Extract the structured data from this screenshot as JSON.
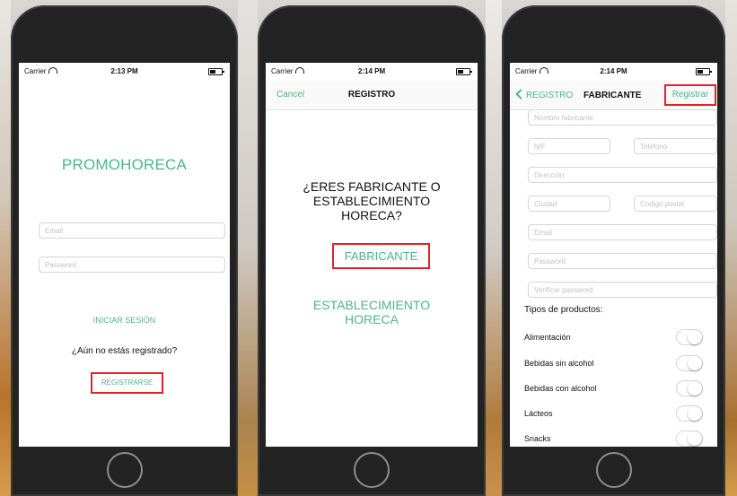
{
  "screen1": {
    "status": {
      "carrier": "Carrier",
      "time": "2:13 PM"
    },
    "app_title": "PROMOHORECA",
    "email_placeholder": "Email",
    "password_placeholder": "Password",
    "login_button": "INICIAR SESIÓN",
    "not_registered": "¿Aún no estás registrado?",
    "register_button": "REGISTRARSE"
  },
  "screen2": {
    "status": {
      "carrier": "Carrier",
      "time": "2:14 PM"
    },
    "nav": {
      "cancel": "Cancel",
      "title": "REGISTRO"
    },
    "question": "¿ERES FABRICANTE O ESTABLECIMIENTO HORECA?",
    "option_fabricante": "FABRICANTE",
    "option_establecimiento": "ESTABLECIMIENTO HORECA"
  },
  "screen3": {
    "status": {
      "carrier": "Carrier",
      "time": "2:14 PM"
    },
    "nav": {
      "back": "REGISTRO",
      "title": "FABRICANTE",
      "action": "Registrar"
    },
    "fields": {
      "nombre": "Nombre fabricante",
      "nif": "NIF",
      "telefono": "Teléfono",
      "direccion": "Dirección",
      "ciudad": "Ciudad",
      "codigo_postal": "Codigo postal",
      "email": "Email",
      "password": "Password",
      "verificar": "Verificar password"
    },
    "tipos_label": "Tipos de productos:",
    "product_types": [
      "Alimentación",
      "Bebidas sin alcohol",
      "Bebidas con alcohol",
      "Lácteos",
      "Snacks"
    ]
  },
  "colors": {
    "accent": "#4fb38d",
    "highlight": "#e0232a",
    "phone_body": "#232323"
  }
}
